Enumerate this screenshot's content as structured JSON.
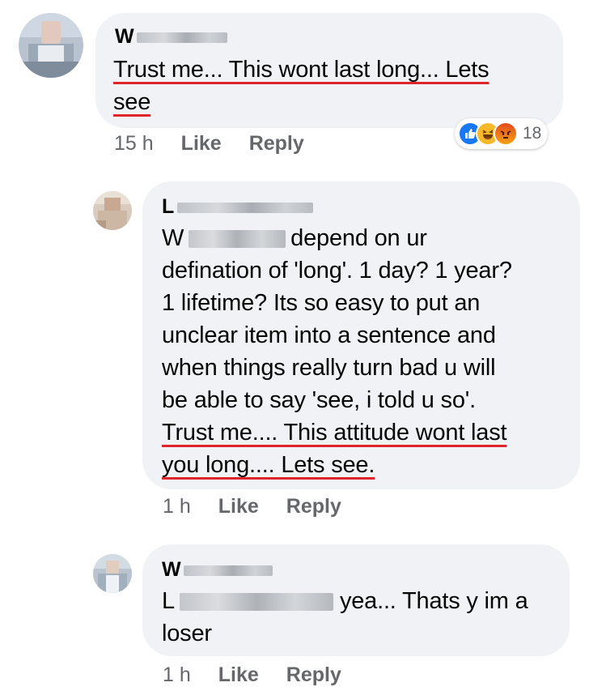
{
  "comments": [
    {
      "author_initial": "W",
      "text_lines": [
        "Trust me... This wont last long... Lets",
        "see"
      ],
      "time": "15 h",
      "like_label": "Like",
      "reply_label": "Reply",
      "reaction_count": "18",
      "reactions": [
        "like-icon",
        "haha-icon",
        "angry-icon"
      ]
    },
    {
      "author_initial": "L",
      "mention_initial": "W",
      "line1_after_mention": "depend on ur",
      "text_lines": [
        "defination of 'long'. 1 day? 1 year?",
        "1 lifetime? Its so easy to put an",
        "unclear item into a sentence and",
        "when things really turn bad u will",
        "be able to say 'see, i told u so'."
      ],
      "underlined_lines": [
        "Trust me.... This attitude wont last",
        "you long.... Lets see."
      ],
      "time": "1 h",
      "like_label": "Like",
      "reply_label": "Reply"
    },
    {
      "author_initial": "W",
      "mention_initial": "L",
      "line1_after_mention": "yea... Thats y im a",
      "text_lines": [
        "loser"
      ],
      "time": "1 h",
      "like_label": "Like",
      "reply_label": "Reply"
    }
  ],
  "colors": {
    "bubble": "#f0f2f5",
    "underline": "#e0242b",
    "meta": "#65676b",
    "like_blue": "#1877f2",
    "haha_yellow": "#f7b928",
    "angry_orange": "#e9710f"
  }
}
